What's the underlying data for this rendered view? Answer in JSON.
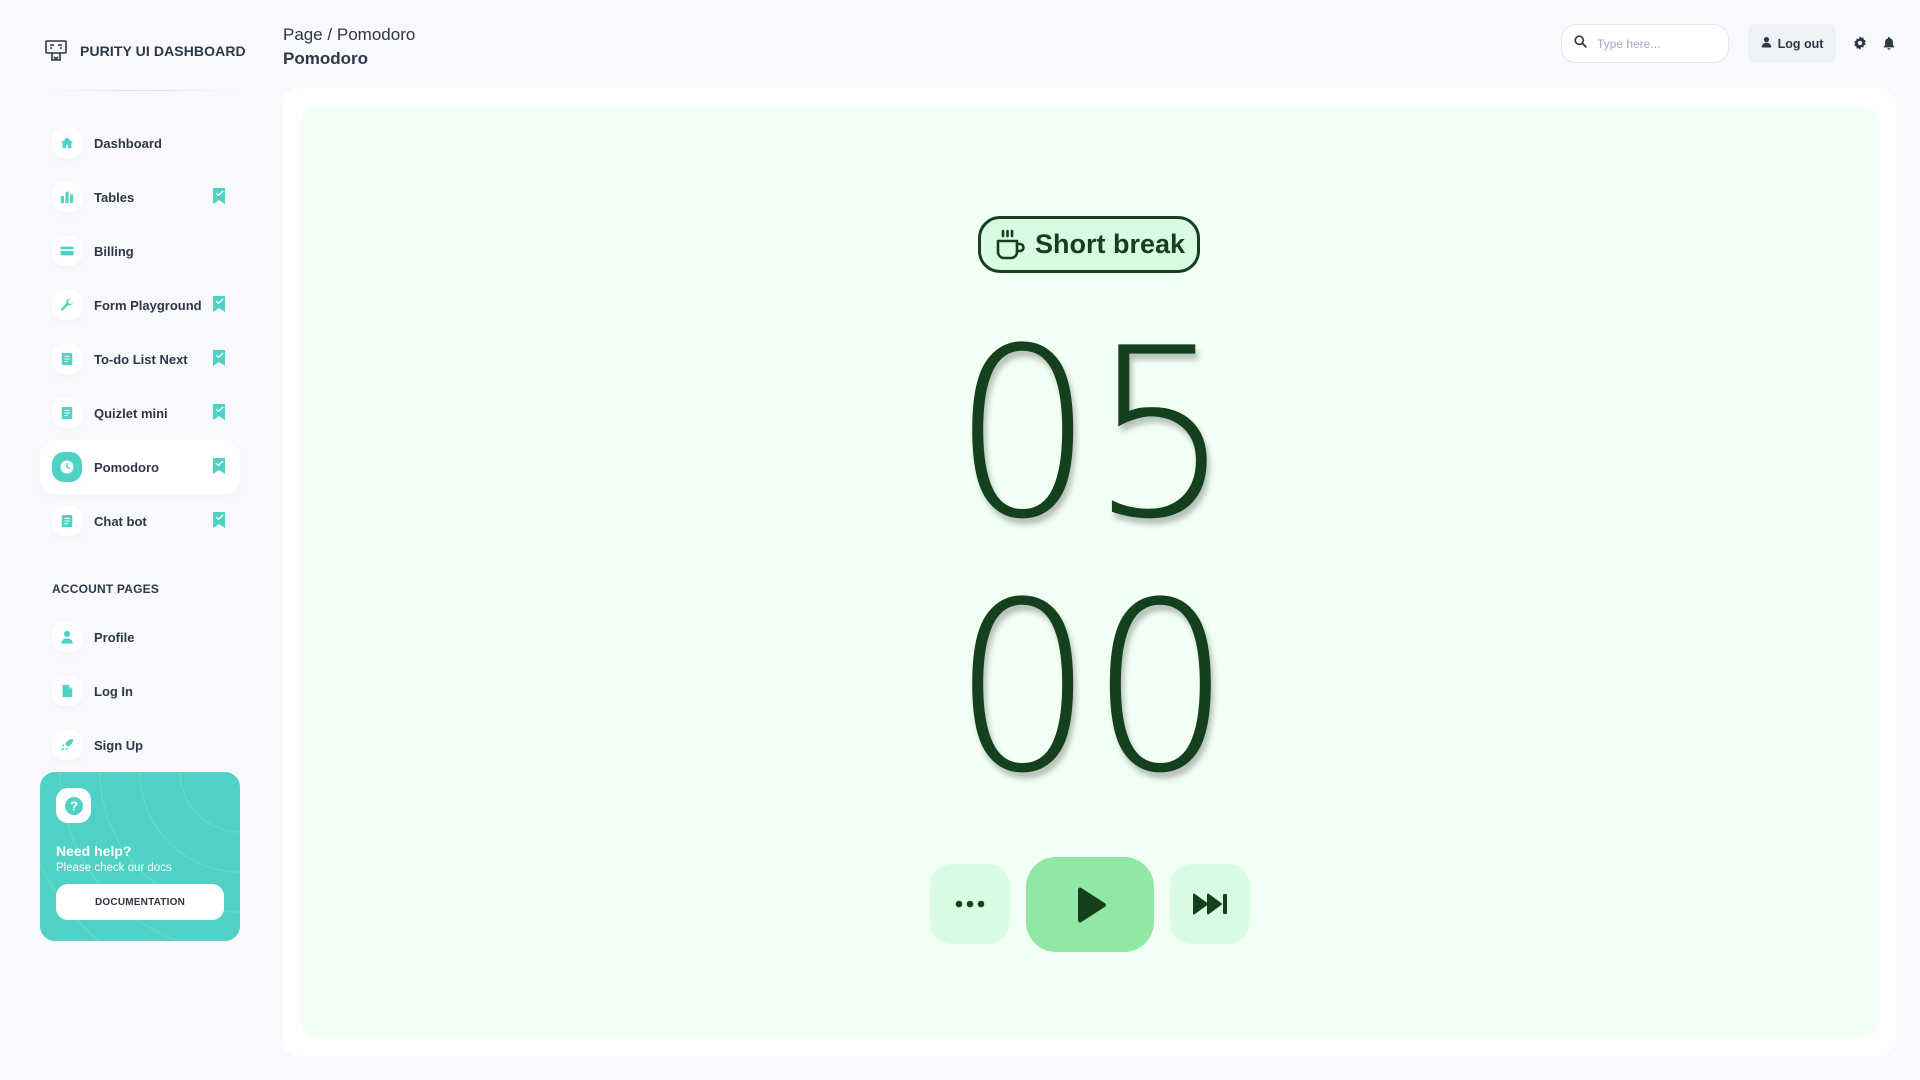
{
  "brand": {
    "name": "PURITY UI DASHBOARD",
    "logo": "dashboard-logo-icon"
  },
  "sidebar": {
    "items": [
      {
        "label": "Dashboard",
        "icon": "home-icon",
        "bookmark": false,
        "active": false
      },
      {
        "label": "Tables",
        "icon": "bar-chart-icon",
        "bookmark": true,
        "active": false
      },
      {
        "label": "Billing",
        "icon": "credit-card-icon",
        "bookmark": false,
        "active": false
      },
      {
        "label": "Form Playground",
        "icon": "wrench-icon",
        "bookmark": true,
        "active": false
      },
      {
        "label": "To-do List Next",
        "icon": "document-icon",
        "bookmark": true,
        "active": false
      },
      {
        "label": "Quizlet mini",
        "icon": "document-icon",
        "bookmark": true,
        "active": false
      },
      {
        "label": "Pomodoro",
        "icon": "clock-icon",
        "bookmark": true,
        "active": true
      },
      {
        "label": "Chat bot",
        "icon": "document-icon",
        "bookmark": true,
        "active": false
      }
    ],
    "account_title": "ACCOUNT PAGES",
    "account_items": [
      {
        "label": "Profile",
        "icon": "person-icon"
      },
      {
        "label": "Log In",
        "icon": "file-icon"
      },
      {
        "label": "Sign Up",
        "icon": "rocket-icon"
      }
    ],
    "help": {
      "title": "Need help?",
      "subtitle": "Please check our docs",
      "button": "DOCUMENTATION",
      "icon": "question-icon"
    }
  },
  "header": {
    "breadcrumb": "Page / Pomodoro",
    "title": "Pomodoro",
    "search_placeholder": "Type here...",
    "logout_label": "Log out",
    "icons": [
      "gear-icon",
      "bell-icon"
    ]
  },
  "pomodoro": {
    "mode_label": "Short break",
    "mode_icon": "coffee-cup-icon",
    "minutes": "05",
    "seconds": "00",
    "controls": [
      "more-icon",
      "play-icon",
      "skip-forward-icon"
    ]
  },
  "colors": {
    "accent": "#4fd1c5",
    "timer_text": "#14401d",
    "timer_bg": "#f2fff5",
    "pill_bg": "#dafae1",
    "play_bg": "#90e8a4"
  }
}
